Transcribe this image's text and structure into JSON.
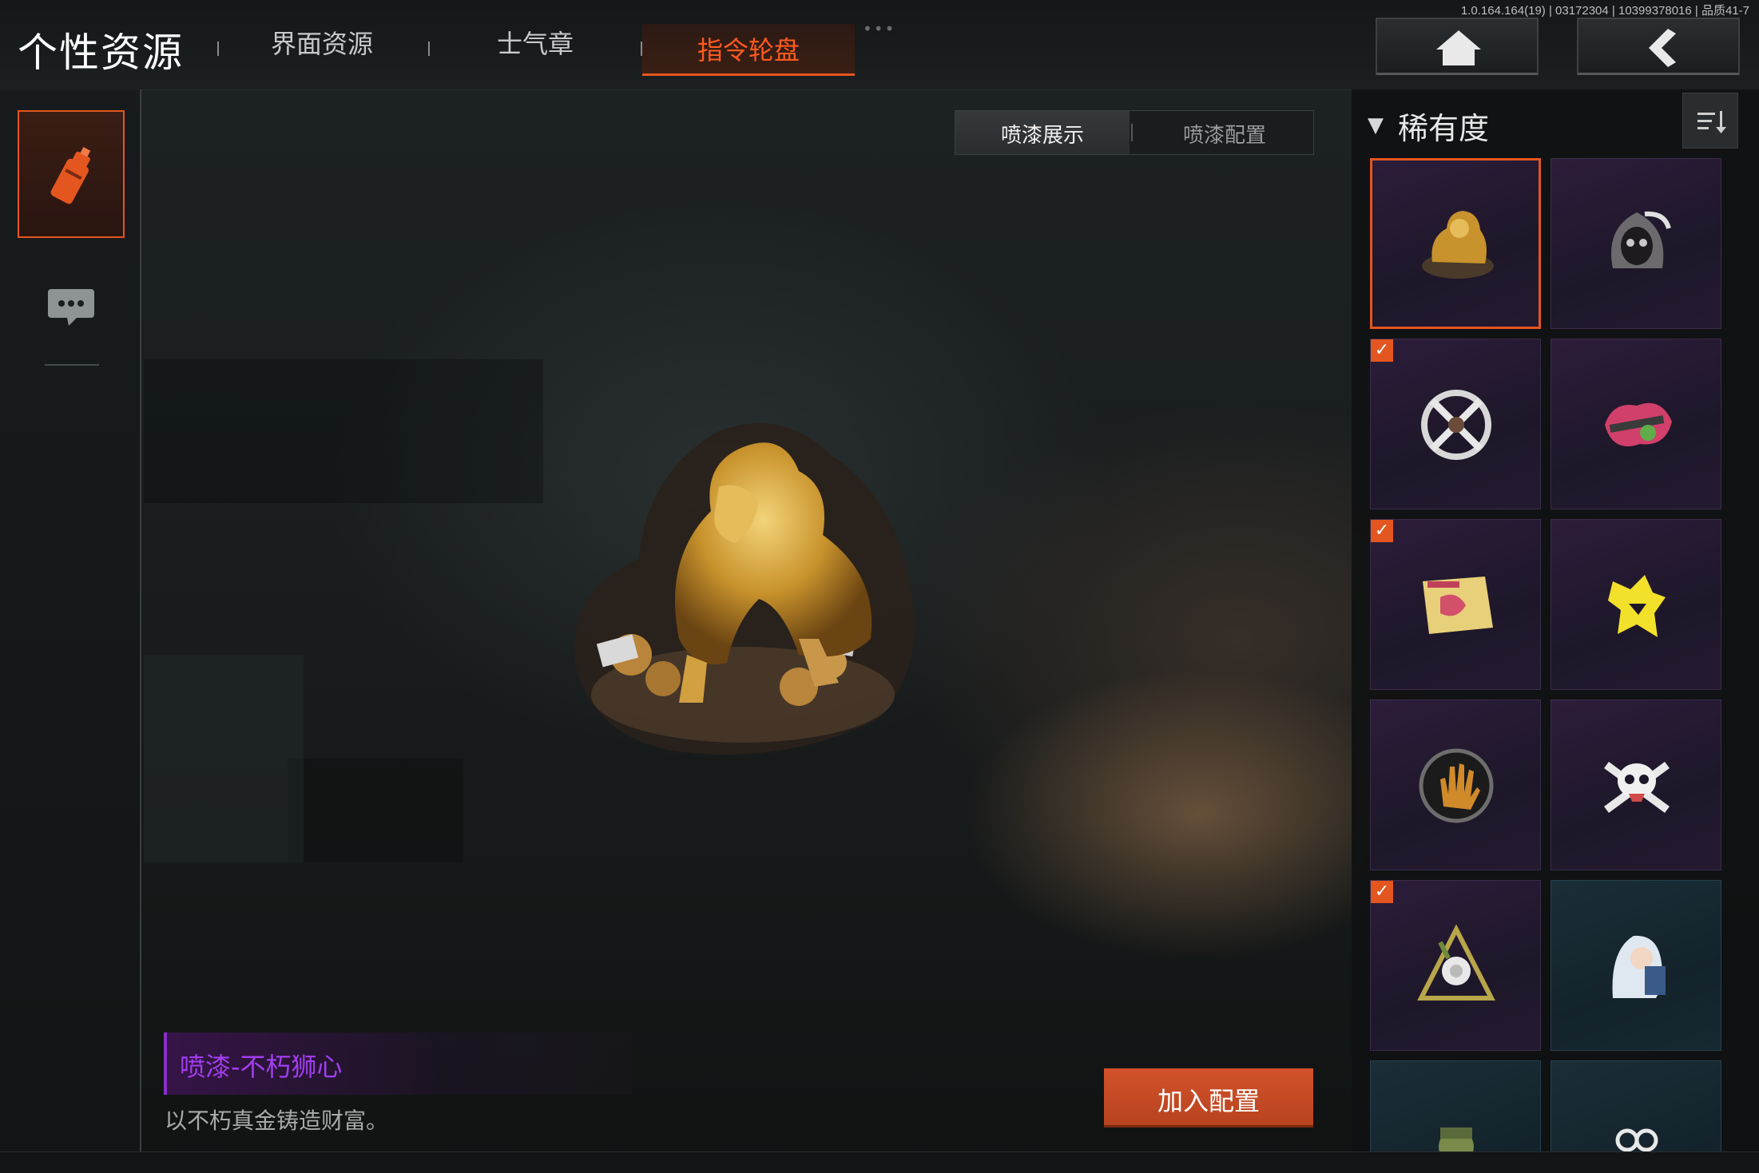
{
  "version_info": "1.0.164.164(19) | 03172304 | 10399378016 | 品质41-7",
  "header": {
    "title": "个性资源",
    "tabs": [
      {
        "label": "界面资源"
      },
      {
        "label": "士气章"
      },
      {
        "label": "指令轮盘",
        "active": true
      }
    ],
    "home_icon": "home-icon",
    "back_icon": "back-chevron-icon"
  },
  "left_rail": {
    "items": [
      {
        "icon": "spray-can-icon",
        "selected": true
      },
      {
        "icon": "chat-bubble-icon",
        "selected": false
      }
    ]
  },
  "segmented": {
    "options": [
      "喷漆展示",
      "喷漆配置"
    ],
    "selected": "喷漆展示"
  },
  "item": {
    "name": "喷漆-不朽狮心",
    "description": "以不朽真金铸造财富。",
    "add_button": "加入配置",
    "art_icon": "golden-lion-spray"
  },
  "filter": {
    "label": "稀有度",
    "sort_icon": "sort-icon"
  },
  "sprays": [
    {
      "icon": "golden-lion-spray",
      "selected": true,
      "checked": false,
      "rarity": "purple"
    },
    {
      "icon": "hooded-skull-spray",
      "selected": false,
      "checked": false,
      "rarity": "purple"
    },
    {
      "icon": "crossed-knives-spray",
      "selected": false,
      "checked": true,
      "rarity": "purple"
    },
    {
      "icon": "pink-splatter-gun-spray",
      "selected": false,
      "checked": false,
      "rarity": "purple"
    },
    {
      "icon": "map-sticker-spray",
      "selected": false,
      "checked": true,
      "rarity": "purple"
    },
    {
      "icon": "yellow-wolf-spray",
      "selected": false,
      "checked": false,
      "rarity": "purple"
    },
    {
      "icon": "handprint-badge-spray",
      "selected": false,
      "checked": false,
      "rarity": "purple"
    },
    {
      "icon": "skull-crossbones-spray",
      "selected": false,
      "checked": false,
      "rarity": "purple"
    },
    {
      "icon": "rose-triangle-spray",
      "selected": false,
      "checked": true,
      "rarity": "purple"
    },
    {
      "icon": "anime-girl-spray",
      "selected": false,
      "checked": false,
      "rarity": "blue"
    },
    {
      "icon": "soldier-cartoon-spray",
      "selected": false,
      "checked": false,
      "rarity": "blue"
    },
    {
      "icon": "orange-tag-spray",
      "selected": false,
      "checked": false,
      "rarity": "blue"
    }
  ],
  "colors": {
    "accent": "#e4561f",
    "rarity_purple": "#2c1d3a",
    "rarity_blue": "#1a2e38",
    "name_purple": "#a23ef0"
  }
}
